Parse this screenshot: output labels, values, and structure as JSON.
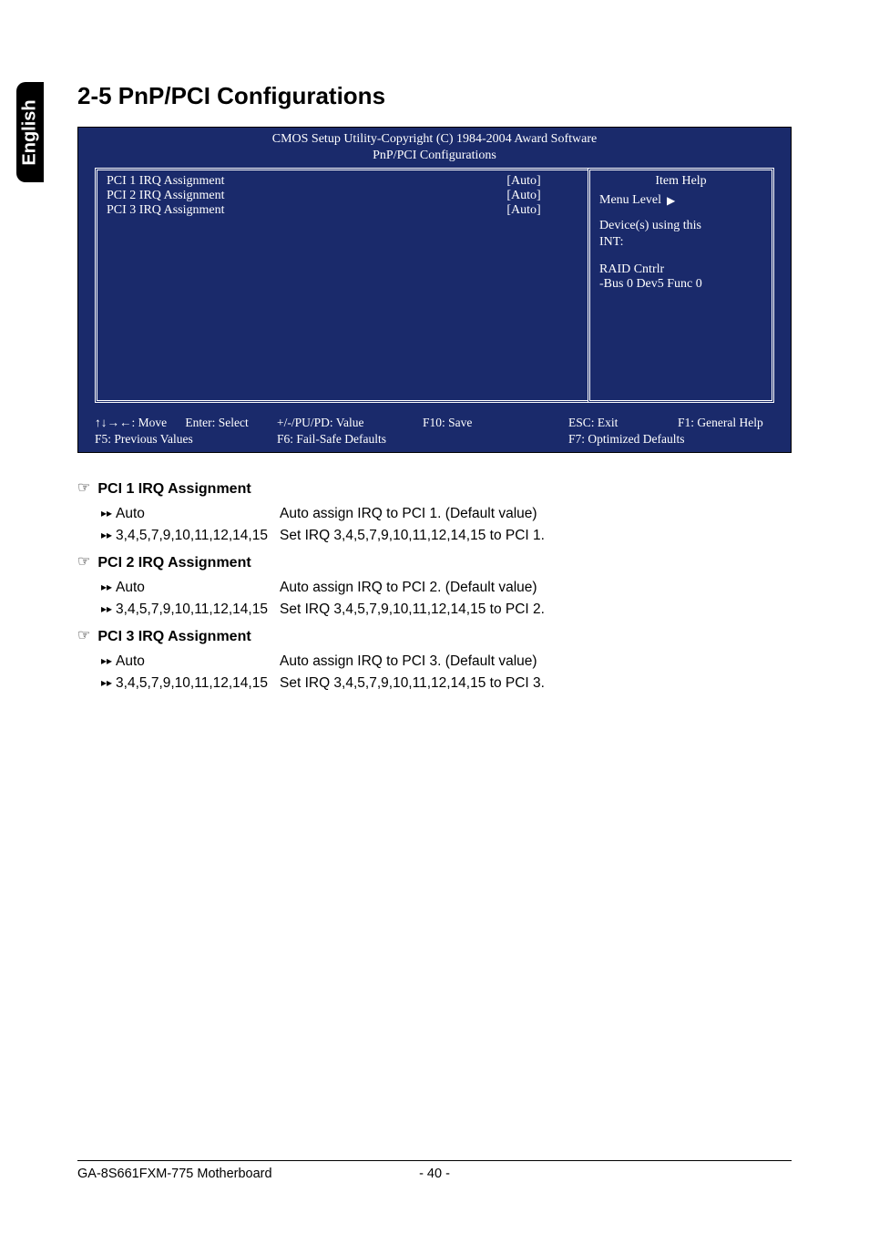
{
  "side_tab": "English",
  "section_title": "2-5   PnP/PCI Configurations",
  "bios": {
    "header_line1": "CMOS Setup Utility-Copyright (C) 1984-2004 Award Software",
    "header_line2": "PnP/PCI Configurations",
    "rows": [
      {
        "label": "PCI 1 IRQ Assignment",
        "value": "[Auto]"
      },
      {
        "label": "PCI 2 IRQ Assignment",
        "value": "[Auto]"
      },
      {
        "label": "PCI 3 IRQ Assignment",
        "value": "[Auto]"
      }
    ],
    "help": {
      "title": "Item Help",
      "menu_level_label": "Menu Level",
      "device_line1": "Device(s) using this",
      "device_line2": "INT:",
      "raid_line1": "RAID Cntrlr",
      "raid_line2": "-Bus 0 Dev5 Func 0"
    },
    "footer": {
      "r1c1": "↑↓→←: Move",
      "r1c2": "Enter: Select",
      "r1c3": "+/-/PU/PD: Value",
      "r1c4": "F10: Save",
      "r1c5": "ESC: Exit",
      "r1c6": "F1: General Help",
      "r2c1": "F5: Previous Values",
      "r2c3": "F6: Fail-Safe Defaults",
      "r2c5": "F7: Optimized Defaults"
    }
  },
  "settings": [
    {
      "name": "PCI 1 IRQ Assignment",
      "options": [
        {
          "label": "Auto",
          "desc": "Auto assign IRQ to PCI 1. (Default value)"
        },
        {
          "label": "3,4,5,7,9,10,11,12,14,15",
          "desc": "Set IRQ 3,4,5,7,9,10,11,12,14,15 to PCI 1."
        }
      ]
    },
    {
      "name": "PCI 2 IRQ Assignment",
      "options": [
        {
          "label": "Auto",
          "desc": "Auto assign IRQ to PCI 2. (Default value)"
        },
        {
          "label": "3,4,5,7,9,10,11,12,14,15",
          "desc": "Set IRQ 3,4,5,7,9,10,11,12,14,15 to PCI 2."
        }
      ]
    },
    {
      "name": "PCI 3 IRQ Assignment",
      "options": [
        {
          "label": "Auto",
          "desc": "Auto assign IRQ to PCI 3. (Default value)"
        },
        {
          "label": "3,4,5,7,9,10,11,12,14,15",
          "desc": "Set IRQ 3,4,5,7,9,10,11,12,14,15 to PCI 3."
        }
      ]
    }
  ],
  "footer": {
    "left": "GA-8S661FXM-775 Motherboard",
    "center": "- 40 -"
  }
}
